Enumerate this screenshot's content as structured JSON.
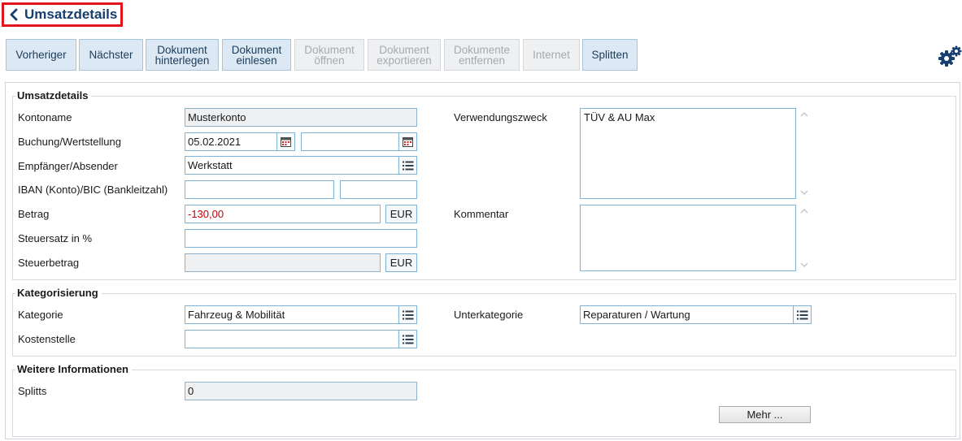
{
  "header": {
    "title": "Umsatzdetails"
  },
  "toolbar": {
    "prev": "Vorheriger",
    "next": "Nächster",
    "doc_store": "Dokument\nhinterlegen",
    "doc_read": "Dokument\neinlesen",
    "doc_open": "Dokument\nöffnen",
    "doc_export": "Dokument\nexportieren",
    "doc_remove": "Dokumente\nentfernen",
    "internet": "Internet",
    "split": "Splitten"
  },
  "sections": {
    "details": {
      "legend": "Umsatzdetails",
      "kontoname_label": "Kontoname",
      "kontoname_value": "Musterkonto",
      "buchung_label": "Buchung/Wertstellung",
      "buchung_value": "05.02.2021",
      "wertstellung_value": "",
      "empfaenger_label": "Empfänger/Absender",
      "empfaenger_value": "Werkstatt",
      "iban_label": "IBAN (Konto)/BIC (Bankleitzahl)",
      "iban_value": "",
      "bic_value": "",
      "betrag_label": "Betrag",
      "betrag_value": "-130,00",
      "betrag_currency": "EUR",
      "steuersatz_label": "Steuersatz in %",
      "steuersatz_value": "",
      "steuerbetrag_label": "Steuerbetrag",
      "steuerbetrag_value": "",
      "steuerbetrag_currency": "EUR",
      "verwendungszweck_label": "Verwendungszweck",
      "verwendungszweck_value": "TÜV & AU Max",
      "kommentar_label": "Kommentar",
      "kommentar_value": ""
    },
    "kategorisierung": {
      "legend": "Kategorisierung",
      "kategorie_label": "Kategorie",
      "kategorie_value": "Fahrzeug & Mobilität",
      "unterkategorie_label": "Unterkategorie",
      "unterkategorie_value": "Reparaturen / Wartung",
      "kostenstelle_label": "Kostenstelle",
      "kostenstelle_value": ""
    },
    "weitere": {
      "legend": "Weitere Informationen",
      "splitts_label": "Splitts",
      "splitts_value": "0",
      "mehr_label": "Mehr ..."
    }
  },
  "colors": {
    "accent": "#163e6e",
    "highlight_border": "#e2141c",
    "negative": "#c40000"
  },
  "icons": [
    "chevron-left-icon",
    "gear-icon",
    "calendar-icon",
    "list-icon",
    "scroll-up-icon",
    "scroll-down-icon"
  ]
}
